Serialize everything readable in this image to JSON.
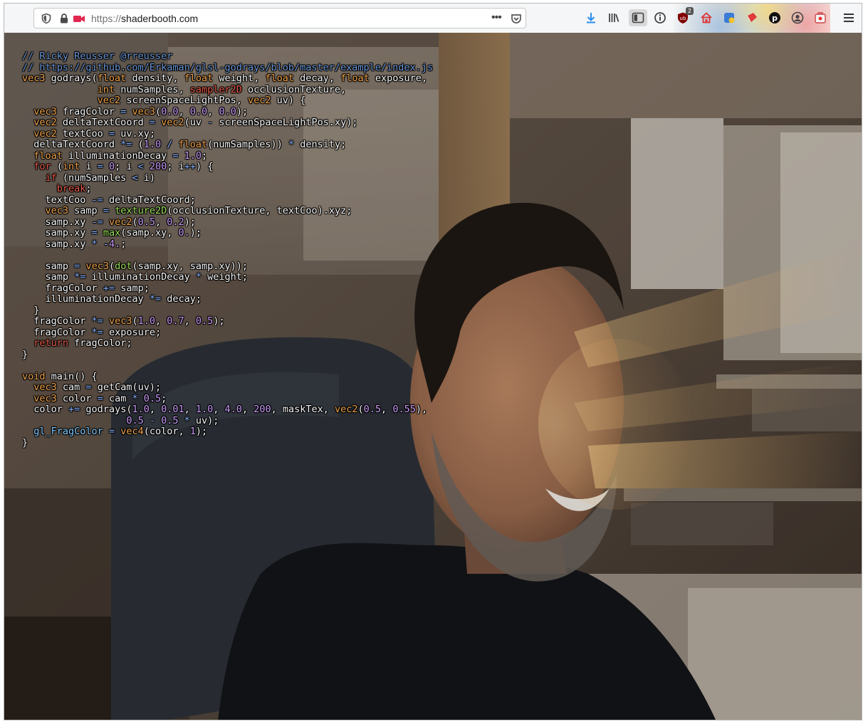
{
  "browser": {
    "url_scheme": "https://",
    "url_host": "shaderbooth.com",
    "page_actions_label": "•••",
    "library_badge": "2",
    "toolbar_icons": [
      "shield-icon",
      "lock-icon",
      "camera-icon",
      "pocket-icon",
      "download-icon",
      "library-icon",
      "sidebar-icon",
      "info-icon",
      "ublock-icon",
      "home-icon",
      "extension-icon",
      "container-icon",
      "p-icon",
      "account-icon",
      "extension-badge-icon",
      "menu-icon"
    ]
  },
  "colors": {
    "accent_download": "#2a8cf0",
    "camera_red": "#e22850",
    "comment": "#6a96d6",
    "type": "#f0a24a",
    "keyword": "#e85a4a",
    "function": "#9be05a",
    "number": "#c99af7",
    "operator": "#8ab4ff"
  },
  "code": {
    "lines": [
      [
        [
          "cm",
          "// Ricky Reusser @rreusser"
        ]
      ],
      [
        [
          "cm",
          "// https://github.com/Erkaman/glsl-godrays/blob/master/example/index.js"
        ]
      ],
      [
        [
          "ty",
          "vec3"
        ],
        [
          "tx",
          " godrays("
        ],
        [
          "ty",
          "float"
        ],
        [
          "tx",
          " density, "
        ],
        [
          "ty",
          "float"
        ],
        [
          "tx",
          " weight, "
        ],
        [
          "ty",
          "float"
        ],
        [
          "tx",
          " decay, "
        ],
        [
          "ty",
          "float"
        ],
        [
          "tx",
          " exposure,"
        ]
      ],
      [
        [
          "tx",
          "             "
        ],
        [
          "ty",
          "int"
        ],
        [
          "tx",
          " numSamples, "
        ],
        [
          "kw",
          "sampler2D"
        ],
        [
          "tx",
          " occlusionTexture,"
        ]
      ],
      [
        [
          "tx",
          "             "
        ],
        [
          "ty",
          "vec2"
        ],
        [
          "tx",
          " screenSpaceLightPos, "
        ],
        [
          "ty",
          "vec2"
        ],
        [
          "tx",
          " uv) {"
        ]
      ],
      [
        [
          "tx",
          "  "
        ],
        [
          "ty",
          "vec3"
        ],
        [
          "tx",
          " fragColor "
        ],
        [
          "op",
          "="
        ],
        [
          "tx",
          " "
        ],
        [
          "ty",
          "vec3"
        ],
        [
          "tx",
          "("
        ],
        [
          "nm",
          "0.0"
        ],
        [
          "tx",
          ", "
        ],
        [
          "nm",
          "0.0"
        ],
        [
          "tx",
          ", "
        ],
        [
          "nm",
          "0.0"
        ],
        [
          "tx",
          ");"
        ]
      ],
      [
        [
          "tx",
          "  "
        ],
        [
          "ty",
          "vec2"
        ],
        [
          "tx",
          " deltaTextCoord "
        ],
        [
          "op",
          "="
        ],
        [
          "tx",
          " "
        ],
        [
          "ty",
          "vec2"
        ],
        [
          "tx",
          "(uv "
        ],
        [
          "op",
          "-"
        ],
        [
          "tx",
          " screenSpaceLightPos.xy);"
        ]
      ],
      [
        [
          "tx",
          "  "
        ],
        [
          "ty",
          "vec2"
        ],
        [
          "tx",
          " textCoo "
        ],
        [
          "op",
          "="
        ],
        [
          "tx",
          " uv.xy;"
        ]
      ],
      [
        [
          "tx",
          "  deltaTextCoord "
        ],
        [
          "op",
          "*="
        ],
        [
          "tx",
          " ("
        ],
        [
          "nm",
          "1.0"
        ],
        [
          "tx",
          " "
        ],
        [
          "op",
          "/"
        ],
        [
          "tx",
          " "
        ],
        [
          "ty",
          "float"
        ],
        [
          "tx",
          "(numSamples)) "
        ],
        [
          "op",
          "*"
        ],
        [
          "tx",
          " density;"
        ]
      ],
      [
        [
          "tx",
          "  "
        ],
        [
          "ty",
          "float"
        ],
        [
          "tx",
          " illuminationDecay "
        ],
        [
          "op",
          "="
        ],
        [
          "tx",
          " "
        ],
        [
          "nm",
          "1.0"
        ],
        [
          "tx",
          ";"
        ]
      ],
      [
        [
          "tx",
          "  "
        ],
        [
          "kw",
          "for"
        ],
        [
          "tx",
          " ("
        ],
        [
          "ty",
          "int"
        ],
        [
          "tx",
          " i "
        ],
        [
          "op",
          "="
        ],
        [
          "tx",
          " "
        ],
        [
          "nm",
          "0"
        ],
        [
          "tx",
          "; i "
        ],
        [
          "op",
          "<"
        ],
        [
          "tx",
          " "
        ],
        [
          "nm",
          "200"
        ],
        [
          "tx",
          "; i"
        ],
        [
          "op",
          "++"
        ],
        [
          "tx",
          ") {"
        ]
      ],
      [
        [
          "tx",
          "    "
        ],
        [
          "kw",
          "if"
        ],
        [
          "tx",
          " (numSamples "
        ],
        [
          "op",
          "<"
        ],
        [
          "tx",
          " i)"
        ]
      ],
      [
        [
          "tx",
          "      "
        ],
        [
          "kw",
          "break"
        ],
        [
          "tx",
          ";"
        ]
      ],
      [
        [
          "tx",
          "    textCoo "
        ],
        [
          "op",
          "-="
        ],
        [
          "tx",
          " deltaTextCoord;"
        ]
      ],
      [
        [
          "tx",
          "    "
        ],
        [
          "ty",
          "vec3"
        ],
        [
          "tx",
          " samp "
        ],
        [
          "op",
          "="
        ],
        [
          "tx",
          " "
        ],
        [
          "fn",
          "texture2D"
        ],
        [
          "tx",
          "(occlusionTexture, textCoo).xyz;"
        ]
      ],
      [
        [
          "tx",
          "    samp.xy "
        ],
        [
          "op",
          "-="
        ],
        [
          "tx",
          " "
        ],
        [
          "ty",
          "vec2"
        ],
        [
          "tx",
          "("
        ],
        [
          "nm",
          "0.5"
        ],
        [
          "tx",
          ", "
        ],
        [
          "nm",
          "0.2"
        ],
        [
          "tx",
          ");"
        ]
      ],
      [
        [
          "tx",
          "    samp.xy "
        ],
        [
          "op",
          "="
        ],
        [
          "tx",
          " "
        ],
        [
          "fn",
          "max"
        ],
        [
          "tx",
          "(samp.xy, "
        ],
        [
          "nm",
          "0."
        ],
        [
          "tx",
          ");"
        ]
      ],
      [
        [
          "tx",
          "    samp.xy "
        ],
        [
          "op",
          "*"
        ],
        [
          "tx",
          " "
        ],
        [
          "op",
          "-"
        ],
        [
          "nm",
          "4."
        ],
        [
          "tx",
          ";"
        ]
      ],
      [
        [
          "tx",
          ""
        ]
      ],
      [
        [
          "tx",
          "    samp "
        ],
        [
          "op",
          "="
        ],
        [
          "tx",
          " "
        ],
        [
          "ty",
          "vec3"
        ],
        [
          "tx",
          "("
        ],
        [
          "fn",
          "dot"
        ],
        [
          "tx",
          "(samp.xy, samp.xy));"
        ]
      ],
      [
        [
          "tx",
          "    samp "
        ],
        [
          "op",
          "*="
        ],
        [
          "tx",
          " illuminationDecay "
        ],
        [
          "op",
          "*"
        ],
        [
          "tx",
          " weight;"
        ]
      ],
      [
        [
          "tx",
          "    fragColor "
        ],
        [
          "op",
          "+="
        ],
        [
          "tx",
          " samp;"
        ]
      ],
      [
        [
          "tx",
          "    illuminationDecay "
        ],
        [
          "op",
          "*="
        ],
        [
          "tx",
          " decay;"
        ]
      ],
      [
        [
          "tx",
          "  }"
        ]
      ],
      [
        [
          "tx",
          "  fragColor "
        ],
        [
          "op",
          "*="
        ],
        [
          "tx",
          " "
        ],
        [
          "ty",
          "vec3"
        ],
        [
          "tx",
          "("
        ],
        [
          "nm",
          "1.0"
        ],
        [
          "tx",
          ", "
        ],
        [
          "nm",
          "0.7"
        ],
        [
          "tx",
          ", "
        ],
        [
          "nm",
          "0.5"
        ],
        [
          "tx",
          ");"
        ]
      ],
      [
        [
          "tx",
          "  fragColor "
        ],
        [
          "op",
          "*="
        ],
        [
          "tx",
          " exposure;"
        ]
      ],
      [
        [
          "tx",
          "  "
        ],
        [
          "kw",
          "return"
        ],
        [
          "tx",
          " fragColor;"
        ]
      ],
      [
        [
          "tx",
          "}"
        ]
      ],
      [
        [
          "tx",
          ""
        ]
      ],
      [
        [
          "ty",
          "void"
        ],
        [
          "tx",
          " main() {"
        ]
      ],
      [
        [
          "tx",
          "  "
        ],
        [
          "ty",
          "vec3"
        ],
        [
          "tx",
          " cam "
        ],
        [
          "op",
          "="
        ],
        [
          "tx",
          " getCam(uv);"
        ]
      ],
      [
        [
          "tx",
          "  "
        ],
        [
          "ty",
          "vec3"
        ],
        [
          "tx",
          " color "
        ],
        [
          "op",
          "="
        ],
        [
          "tx",
          " cam "
        ],
        [
          "op",
          "*"
        ],
        [
          "tx",
          " "
        ],
        [
          "nm",
          "0.5"
        ],
        [
          "tx",
          ";"
        ]
      ],
      [
        [
          "tx",
          "  color "
        ],
        [
          "op",
          "+="
        ],
        [
          "tx",
          " godrays("
        ],
        [
          "nm",
          "1.0"
        ],
        [
          "tx",
          ", "
        ],
        [
          "nm",
          "0.01"
        ],
        [
          "tx",
          ", "
        ],
        [
          "nm",
          "1.0"
        ],
        [
          "tx",
          ", "
        ],
        [
          "nm",
          "4.0"
        ],
        [
          "tx",
          ", "
        ],
        [
          "nm",
          "200"
        ],
        [
          "tx",
          ", maskTex, "
        ],
        [
          "ty",
          "vec2"
        ],
        [
          "tx",
          "("
        ],
        [
          "nm",
          "0.5"
        ],
        [
          "tx",
          ", "
        ],
        [
          "nm",
          "0.55"
        ],
        [
          "tx",
          "),"
        ]
      ],
      [
        [
          "tx",
          "                  "
        ],
        [
          "nm",
          "0.5"
        ],
        [
          "tx",
          " "
        ],
        [
          "op",
          "-"
        ],
        [
          "tx",
          " "
        ],
        [
          "nm",
          "0.5"
        ],
        [
          "tx",
          " "
        ],
        [
          "op",
          "*"
        ],
        [
          "tx",
          " uv);"
        ]
      ],
      [
        [
          "tx",
          "  "
        ],
        [
          "bu",
          "gl_FragColor"
        ],
        [
          "tx",
          " "
        ],
        [
          "op",
          "="
        ],
        [
          "tx",
          " "
        ],
        [
          "ty",
          "vec4"
        ],
        [
          "tx",
          "(color, "
        ],
        [
          "nm",
          "1"
        ],
        [
          "tx",
          ");"
        ]
      ],
      [
        [
          "tx",
          "}"
        ]
      ]
    ]
  }
}
